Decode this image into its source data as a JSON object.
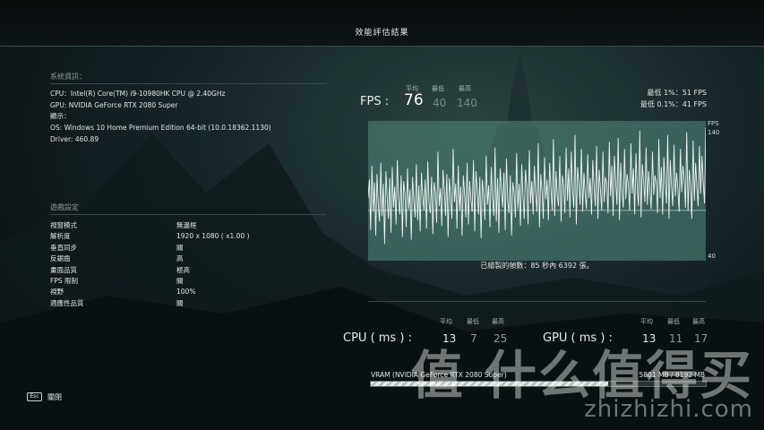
{
  "title": "效能評估結果",
  "system": {
    "heading": "系統資訊：",
    "lines": [
      "CPU：Intel(R) Core(TM) i9-10980HK CPU @ 2.40GHz",
      "GPU: NVIDIA GeForce RTX 2080 Super",
      "顯示：",
      "OS: Windows 10 Home Premium Edition 64-bit (10.0.18362.1130)",
      "Driver: 460.89"
    ]
  },
  "game_settings": {
    "heading": "遊戲設定",
    "rows": [
      {
        "key": "視窗模式",
        "value": "無邊框"
      },
      {
        "key": "解析度",
        "value": "1920 x 1080 ( x1.00 )"
      },
      {
        "key": "垂直同步",
        "value": "關"
      },
      {
        "key": "反鋸齒",
        "value": "高"
      },
      {
        "key": "畫面品質",
        "value": "極高"
      },
      {
        "key": "FPS 限制",
        "value": "關"
      },
      {
        "key": "視野",
        "value": "100%"
      },
      {
        "key": "適應性品質",
        "value": "關"
      }
    ]
  },
  "fps": {
    "label": "FPS :",
    "avg_label": "平均",
    "min_label": "最低",
    "max_label": "最高",
    "avg": "76",
    "min": "40",
    "max": "140",
    "low_1": "最低 1%：51 FPS",
    "low_01": "最低 0.1%：41 FPS"
  },
  "chart_data": {
    "type": "line",
    "title": "",
    "xlabel": "",
    "ylabel": "FPS",
    "ylim": [
      40,
      140
    ],
    "y_ticks": [
      "140",
      "40"
    ],
    "frames_note": "已繪製的幀數：85 秒內 6392 張。",
    "series": [
      {
        "values": [
          85,
          98,
          62,
          108,
          75,
          96,
          58,
          102,
          80,
          68,
          110,
          72,
          95,
          52,
          104,
          86,
          70,
          99,
          60,
          107,
          78,
          93,
          66,
          112,
          84,
          73,
          101,
          57,
          97,
          88,
          64,
          106,
          77,
          91,
          55,
          100,
          83,
          71,
          109,
          69,
          94,
          61,
          103,
          87,
          76,
          98,
          63,
          111,
          81,
          74,
          100,
          59,
          96,
          89,
          67,
          118,
          79,
          92,
          65,
          105,
          90,
          72,
          102,
          57,
          99,
          86,
          70,
          120,
          82,
          95,
          63,
          108,
          76,
          93,
          58,
          101,
          88,
          71,
          110,
          66,
          97,
          84,
          75,
          112,
          61,
          104,
          90,
          73,
          100,
          56,
          98,
          87,
          69,
          115,
          80,
          94,
          64,
          107,
          85,
          72,
          121,
          68,
          99,
          60,
          106,
          91,
          78,
          103,
          62,
          113,
          83,
          74,
          101,
          58,
          96,
          89,
          71,
          117,
          77,
          95,
          65,
          109,
          86,
          70,
          105,
          93,
          66,
          119,
          81,
          97,
          73,
          108,
          88,
          75,
          124,
          64,
          102,
          90,
          70,
          114,
          84,
          98,
          69,
          110,
          92,
          76,
          127,
          72,
          104,
          87,
          79,
          115,
          68,
          101,
          94,
          74,
          121,
          83,
          106,
          71,
          118,
          90,
          78,
          130,
          66,
          107,
          96,
          80,
          120,
          75,
          103,
          88,
          77,
          116,
          85,
          99,
          73,
          112,
          93,
          79,
          122,
          70,
          105,
          91,
          76,
          118,
          82,
          100,
          95,
          74,
          125,
          86,
          108,
          72,
          115,
          97,
          80,
          128,
          69,
          110,
          89,
          78,
          120,
          84,
          102,
          94,
          76,
          124,
          88,
          106,
          73,
          117,
          92,
          79,
          133,
          71,
          109,
          97,
          82,
          121,
          80,
          104,
          90,
          77,
          118,
          87,
          101,
          96,
          74,
          127,
          85,
          107,
          73,
          114,
          95,
          81,
          130,
          70,
          112,
          93,
          79,
          123,
          86,
          103,
          91,
          75,
          120,
          89,
          108,
          98,
          78,
          132,
          76,
          105,
          94,
          70,
          126,
          83,
          110,
          92,
          79,
          122,
          88,
          115,
          96,
          81,
          135
        ]
      }
    ]
  },
  "cpu_ms": {
    "label": "CPU ( ms ) :",
    "avg_label": "平均",
    "min_label": "最低",
    "max_label": "最高",
    "avg": "13",
    "min": "7",
    "max": "25"
  },
  "gpu_ms": {
    "label": "GPU ( ms ) :",
    "avg_label": "平均",
    "min_label": "最低",
    "max_label": "最高",
    "avg": "13",
    "min": "11",
    "max": "17"
  },
  "vram": {
    "label": "VRAM (NVIDIA GeForce RTX 2080 Super)",
    "value": "5801 MB / 8192 MB",
    "used_mb": 5801,
    "total_mb": 8192
  },
  "footer": {
    "esc_key": "Esc",
    "close_label": "關閉"
  },
  "watermark": {
    "text": "值 什么值得买",
    "url": "zhizhizhi.com"
  }
}
